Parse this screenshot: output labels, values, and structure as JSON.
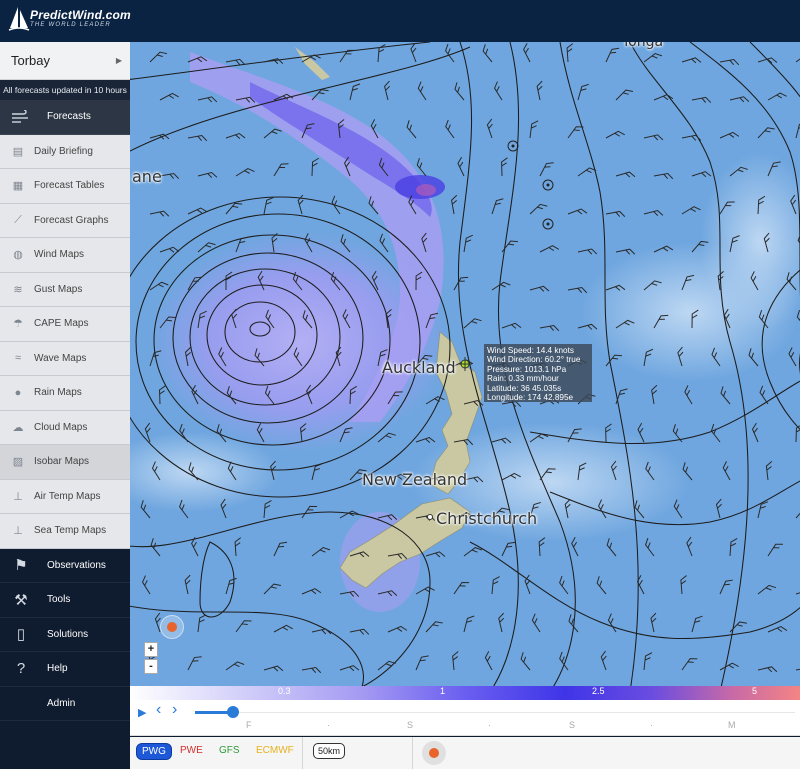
{
  "app": {
    "brand": "PredictWind.com",
    "tagline": "THE WORLD LEADER"
  },
  "sidebar": {
    "location": "Torbay",
    "updated_note": "All forecasts updated in 10 hours",
    "forecasts_label": "Forecasts",
    "forecast_items": [
      {
        "label": "Daily Briefing",
        "icon": "briefing-icon"
      },
      {
        "label": "Forecast Tables",
        "icon": "table-icon"
      },
      {
        "label": "Forecast Graphs",
        "icon": "graph-icon"
      },
      {
        "label": "Wind Maps",
        "icon": "globe-icon"
      },
      {
        "label": "Gust Maps",
        "icon": "gust-icon"
      },
      {
        "label": "CAPE Maps",
        "icon": "storm-icon"
      },
      {
        "label": "Wave Maps",
        "icon": "wave-icon"
      },
      {
        "label": "Rain Maps",
        "icon": "raindrop-icon"
      },
      {
        "label": "Cloud Maps",
        "icon": "cloud-icon"
      },
      {
        "label": "Isobar Maps",
        "icon": "isobar-icon"
      },
      {
        "label": "Air Temp Maps",
        "icon": "thermometer-icon"
      },
      {
        "label": "Sea Temp Maps",
        "icon": "sea-temp-icon"
      }
    ],
    "selected_item": "Isobar Maps",
    "bottom_items": [
      {
        "label": "Observations",
        "icon": "flags-icon"
      },
      {
        "label": "Tools",
        "icon": "hammer-icon"
      },
      {
        "label": "Solutions",
        "icon": "phone-icon"
      },
      {
        "label": "Help",
        "icon": "help-icon"
      },
      {
        "label": "Admin",
        "icon": ""
      }
    ]
  },
  "map": {
    "place_labels": [
      "Tonga",
      "ane",
      "Auckland",
      "New Zealand",
      "Christchurch"
    ],
    "tooltip": {
      "wind_speed": "Wind Speed: 14.4 knots",
      "wind_direction": "Wind Direction: 60.2° true",
      "pressure": "Pressure: 1013.1 hPa",
      "rain": "Rain: 0.33 mm/hour",
      "latitude": "Latitude: 36 45.035s",
      "longitude": "Longitude: 174 42.895e"
    },
    "zoom_in": "+",
    "zoom_out": "-"
  },
  "legend": {
    "ticks": [
      "0.3",
      "1",
      "2.5",
      "5"
    ]
  },
  "timeline": {
    "play": "▶",
    "prev": "‹",
    "next": "›",
    "day_ticks": [
      "F",
      "·",
      "S",
      "·",
      "S",
      "·",
      "M"
    ],
    "position_fraction": 0.06
  },
  "models": {
    "items": [
      "PWG",
      "PWE",
      "GFS",
      "ECMWF"
    ],
    "selected": "PWG",
    "colors": {
      "PWG": "#ffffff",
      "PWE": "#d0302e",
      "GFS": "#2e9a3a",
      "ECMWF": "#e6b21a"
    },
    "scale_label": "50km"
  }
}
